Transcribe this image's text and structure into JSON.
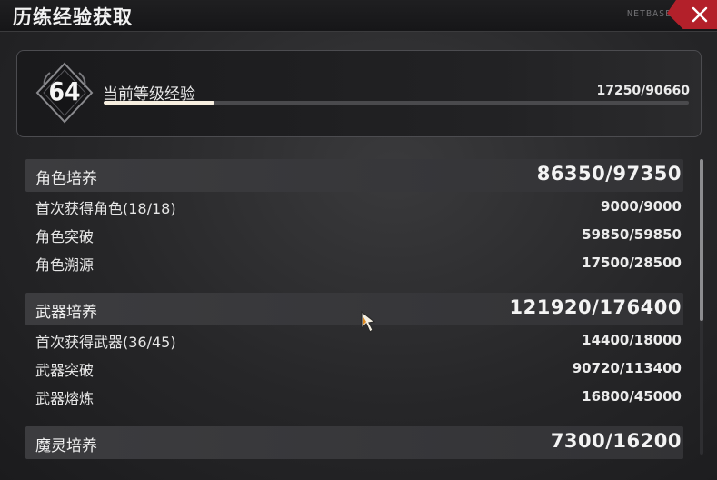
{
  "window": {
    "title": "历练经验获取",
    "brand_mark": "NETBASE"
  },
  "level": {
    "number": "64",
    "label": "当前等级经验",
    "value_text": "17250/90660",
    "progress_fraction": 0.19
  },
  "sections": [
    {
      "label": "角色培养",
      "value": "86350/97350",
      "rows": [
        {
          "label": "首次获得角色(18/18)",
          "value": "9000/9000"
        },
        {
          "label": "角色突破",
          "value": "59850/59850"
        },
        {
          "label": "角色溯源",
          "value": "17500/28500"
        }
      ]
    },
    {
      "label": "武器培养",
      "value": "121920/176400",
      "rows": [
        {
          "label": "首次获得武器(36/45)",
          "value": "14400/18000"
        },
        {
          "label": "武器突破",
          "value": "90720/113400"
        },
        {
          "label": "武器熔炼",
          "value": "16800/45000"
        }
      ]
    },
    {
      "label": "魔灵培养",
      "value": "7300/16200",
      "rows": []
    }
  ],
  "icons": {
    "close": "close-icon",
    "level_badge": "level-emblem-icon",
    "cursor": "mouse-cursor-icon"
  },
  "colors": {
    "close_button": "#b3202a",
    "progress_fill": "#f7efe0",
    "section_bg": "#3c3c3f"
  }
}
